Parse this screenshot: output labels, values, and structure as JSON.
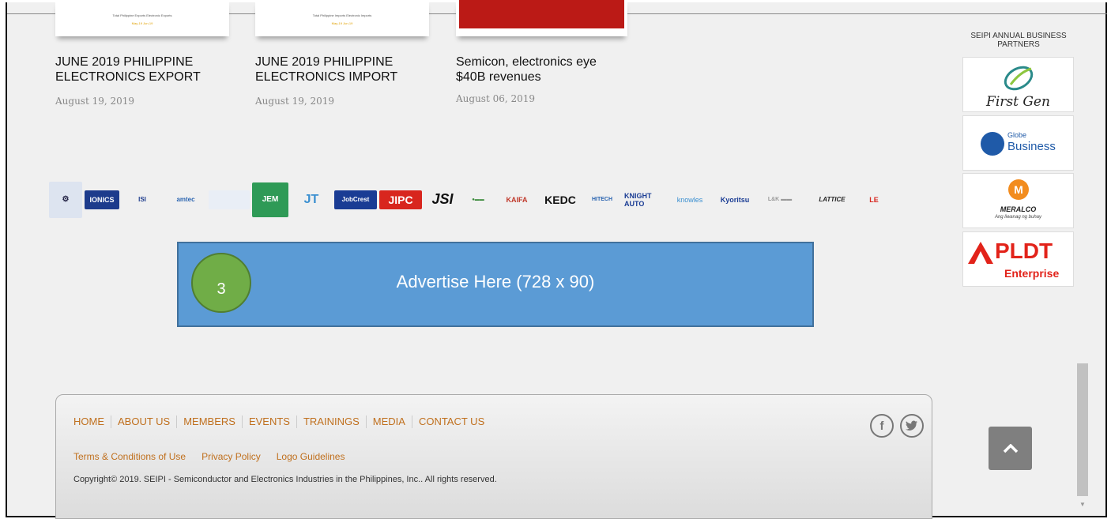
{
  "articles": [
    {
      "thumb_caption": "Total Philippine Exports       Electronic Exports",
      "thumb_legend": "May-19  Jun-19",
      "title_line1": "JUNE 2019 PHILIPPINE",
      "title_line2": "ELECTRONICS EXPORT",
      "date": "August 19, 2019"
    },
    {
      "thumb_caption": "Total Philippine Imports       Electronic Imports",
      "thumb_legend": "May-19  Jun-19",
      "title_line1": "JUNE 2019 PHILIPPINE",
      "title_line2": "ELECTRONICS IMPORT",
      "date": "August 19, 2019"
    },
    {
      "title_line1": "Semicon, electronics eye",
      "title_line2": "$40B revenues",
      "date": "August 06, 2019"
    }
  ],
  "member_logos": [
    "IONICS",
    "ISI",
    "amtec",
    "JEM",
    "JT",
    "JobCrest",
    "JIPC",
    "JSI",
    "KAIFA",
    "KEDC",
    "HITECH",
    "KNIGHT AUTO",
    "knowles",
    "Kyoritsu",
    "LATTICE",
    "LE"
  ],
  "ad": {
    "label": "Advertise Here (728 x 90)",
    "badge": "3"
  },
  "partners": {
    "title": "SEIPI ANNUAL BUSINESS PARTNERS",
    "items": [
      {
        "name": "First Gen"
      },
      {
        "name_top": "Globe",
        "name_bottom": "Business"
      },
      {
        "name": "MERALCO",
        "tagline": "Ang liwanag ng buhay"
      },
      {
        "name": "PLDT",
        "sub": "Enterprise"
      }
    ]
  },
  "footer": {
    "nav": [
      "HOME",
      "ABOUT US",
      "MEMBERS",
      "EVENTS",
      "TRAININGS",
      "MEDIA",
      "CONTACT US"
    ],
    "links": [
      "Terms & Conditions of Use",
      "Privacy Policy",
      "Logo Guidelines"
    ],
    "copyright": "Copyright© 2019. SEIPI - Semiconductor and Electronics Industries in the Philippines, Inc.. All rights reserved.",
    "social": {
      "facebook": "f",
      "twitter": "t"
    }
  },
  "colors": {
    "ad_bg": "#5b9bd5",
    "badge_bg": "#70ad47",
    "link": "#c0701e",
    "pldt_red": "#e2231a"
  }
}
